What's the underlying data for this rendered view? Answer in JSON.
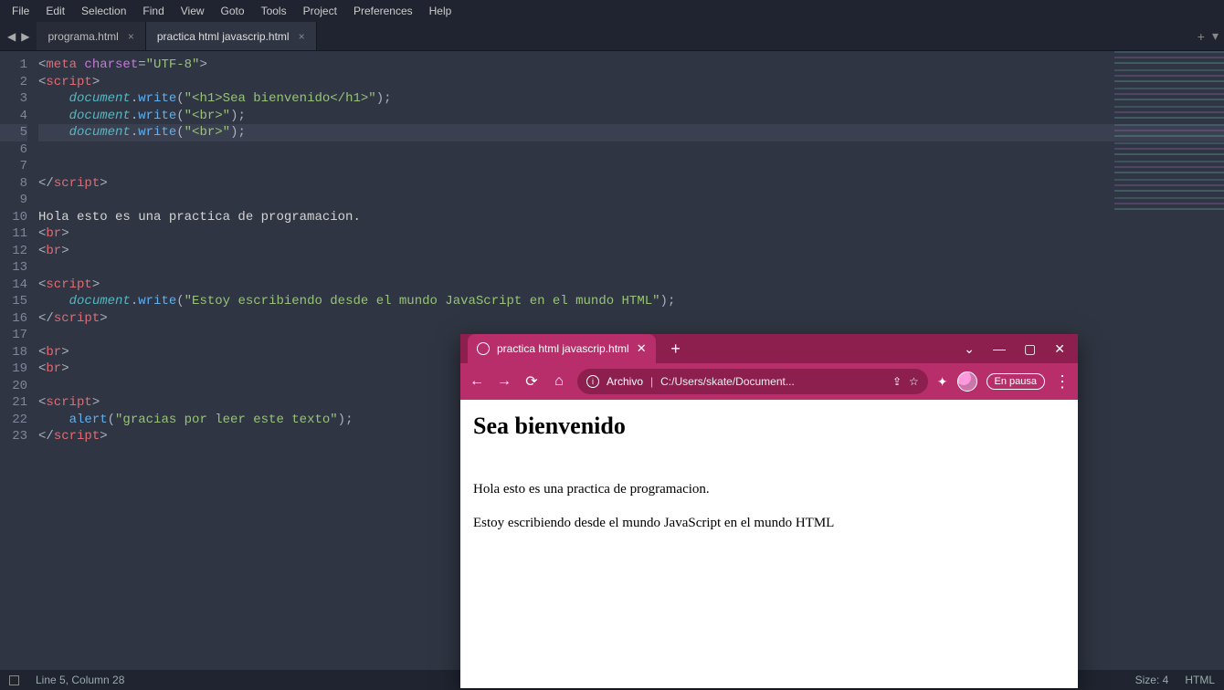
{
  "menu": [
    "File",
    "Edit",
    "Selection",
    "Find",
    "View",
    "Goto",
    "Tools",
    "Project",
    "Preferences",
    "Help"
  ],
  "tabs": [
    {
      "label": "programa.html",
      "active": false
    },
    {
      "label": "practica html javascrip.html",
      "active": true
    }
  ],
  "tab_controls": {
    "new_tab": "+",
    "dropdown": "▾"
  },
  "history_icons": {
    "back": "◀",
    "fwd": "▶"
  },
  "gutter": [
    "1",
    "2",
    "3",
    "4",
    "5",
    "6",
    "7",
    "8",
    "9",
    "10",
    "11",
    "12",
    "13",
    "14",
    "15",
    "16",
    "17",
    "18",
    "19",
    "20",
    "21",
    "22",
    "23"
  ],
  "highlight_line": 5,
  "code": {
    "l1": {
      "a": "<",
      "b": "meta",
      "c": " ",
      "d": "charset",
      "e": "=",
      "f": "\"UTF-8\"",
      "g": ">"
    },
    "l2": {
      "a": "<",
      "b": "script",
      "c": ">"
    },
    "l3": {
      "ind": "    ",
      "obj": "document",
      "dot": ".",
      "fn": "write",
      "op": "(",
      "str": "\"<h1>Sea bienvenido</h1>\"",
      "cl": ");"
    },
    "l4": {
      "ind": "    ",
      "obj": "document",
      "dot": ".",
      "fn": "write",
      "op": "(",
      "str": "\"<br>\"",
      "cl": ");"
    },
    "l5": {
      "ind": "    ",
      "obj": "document",
      "dot": ".",
      "fn": "write",
      "op": "(",
      "str": "\"<br>\"",
      "cl": ");"
    },
    "l8": {
      "a": "</",
      "b": "script",
      "c": ">"
    },
    "l10": "Hola esto es una practica de programacion.",
    "l11": {
      "a": "<",
      "b": "br",
      "c": ">"
    },
    "l12": {
      "a": "<",
      "b": "br",
      "c": ">"
    },
    "l14": {
      "a": "<",
      "b": "script",
      "c": ">"
    },
    "l15": {
      "ind": "    ",
      "obj": "document",
      "dot": ".",
      "fn": "write",
      "op": "(",
      "str": "\"Estoy escribiendo desde el mundo JavaScript en el mundo HTML\"",
      "cl": ");"
    },
    "l16": {
      "a": "</",
      "b": "script",
      "c": ">"
    },
    "l18": {
      "a": "<",
      "b": "br",
      "c": ">"
    },
    "l19": {
      "a": "<",
      "b": "br",
      "c": ">"
    },
    "l21": {
      "a": "<",
      "b": "script",
      "c": ">"
    },
    "l22": {
      "ind": "    ",
      "fn": "alert",
      "op": "(",
      "str": "\"gracias por leer este texto\"",
      "cl": ");"
    },
    "l23": {
      "a": "</",
      "b": "script",
      "c": ">"
    }
  },
  "status": {
    "left": "Line 5, Column 28",
    "right_size": "Size: 4",
    "right_lang": "HTML"
  },
  "browser": {
    "tab_label": "practica html javascrip.html",
    "new_tab": "+",
    "win": {
      "drop": "⌄",
      "min": "—",
      "max": "▢",
      "close": "✕"
    },
    "nav": {
      "back": "←",
      "fwd": "→",
      "reload": "⟳",
      "home": "⌂"
    },
    "addr_prefix": "Archivo",
    "url": "C:/Users/skate/Document...",
    "share_icon": "⇪",
    "star_icon": "☆",
    "ext_icon": "✦",
    "pause_label": "En pausa",
    "kebab": "⋮",
    "page": {
      "h1": "Sea bienvenido",
      "p1": "Hola esto es una practica de programacion.",
      "p2": "Estoy escribiendo desde el mundo JavaScript en el mundo HTML"
    }
  }
}
